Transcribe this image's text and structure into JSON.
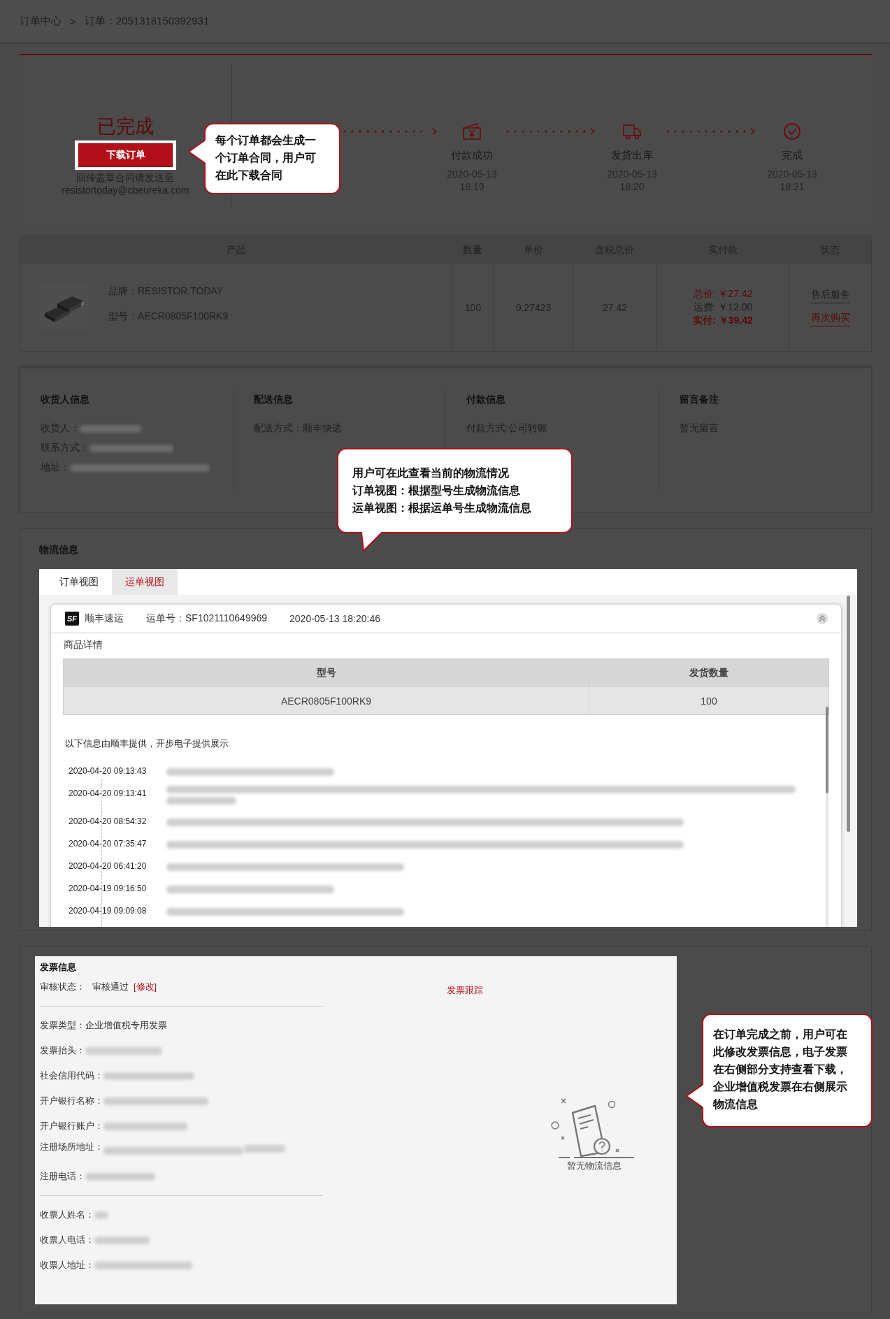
{
  "breadcrumb": {
    "items": [
      "订单中心",
      "订单：2051318150392931"
    ],
    "separator": ">"
  },
  "order_status": {
    "title": "已完成",
    "download_button": "下载订单",
    "note_lines": [
      "回传盖章合同请发送至",
      "resistortoday@cbeureka.com"
    ]
  },
  "steps": [
    {
      "kind": "payment",
      "label": "付款成功",
      "date": "2020-05-13",
      "time": "18:19"
    },
    {
      "kind": "shipping",
      "label": "发货出库",
      "date": "2020-05-13",
      "time": "18:20"
    },
    {
      "kind": "done",
      "label": "完成",
      "date": "2020-05-13",
      "time": "18:21"
    }
  ],
  "product_table": {
    "columns": [
      "产品",
      "数量",
      "单价",
      "含税总价",
      "实付款",
      "状态"
    ],
    "row": {
      "brand": "品牌：RESISTOR.TODAY",
      "model": "型号：AECR0805F100RK9",
      "quantity": "100",
      "unit_price": "0.27423",
      "total": "27.42",
      "payment": [
        {
          "kind": "total",
          "label": "总价:",
          "amount": "￥27.42"
        },
        {
          "kind": "fee",
          "label": "运费:",
          "amount": "￥12.00"
        },
        {
          "kind": "paid",
          "label": "实付:",
          "amount": "￥39.42"
        }
      ],
      "actions": [
        {
          "label": "售后服务",
          "kind": "plain"
        },
        {
          "label": "再次购买",
          "kind": "accent"
        }
      ]
    }
  },
  "info_sections": [
    {
      "title": "收货人信息",
      "fields": [
        {
          "label": "收货人：",
          "redacted": true
        },
        {
          "label": "联系方式：",
          "redacted": true
        },
        {
          "label": "地址：",
          "redacted": true
        }
      ]
    },
    {
      "title": "配送信息",
      "fields": [
        {
          "label": "配送方式：",
          "value": "顺丰快递",
          "redacted": false
        }
      ]
    },
    {
      "title": "付款信息",
      "fields": [
        {
          "label": "付款方式:",
          "value": "公司转账",
          "redacted": false
        }
      ]
    },
    {
      "title": "留言备注",
      "fields": [
        {
          "label": "暂无留言",
          "redacted": false
        }
      ]
    }
  ],
  "logistics": {
    "title": "物流信息",
    "tabs": [
      {
        "label": "订单视图",
        "selected": false
      },
      {
        "label": "运单视图",
        "selected": true
      }
    ],
    "carrier": {
      "logo": "SF",
      "name": "顺丰速运",
      "waybill": "运单号：SF1021110649969",
      "time": "2020-05-13 18:20:46"
    },
    "details_title": "商品详情",
    "details_table": {
      "columns": [
        "型号",
        "发货数量"
      ],
      "rows": [
        [
          "AECR0805F100RK9",
          "100"
        ]
      ]
    },
    "source_note": "以下信息由顺丰提供，开步电子提供展示",
    "events": [
      {
        "time": "2020-04-20 09:13:43",
        "kind": "short"
      },
      {
        "time": "2020-04-20 09:13:41",
        "kind": "double"
      },
      {
        "time": "2020-04-20 08:54:32",
        "kind": "long"
      },
      {
        "time": "2020-04-20 07:35:47",
        "kind": "long"
      },
      {
        "time": "2020-04-20 06:41:20",
        "kind": "medium"
      },
      {
        "time": "2020-04-19 09:16:50",
        "kind": "short"
      },
      {
        "time": "2020-04-19 09:09:08",
        "kind": "medium"
      }
    ]
  },
  "invoice": {
    "title": "发票信息",
    "review_label": "审核状态：",
    "review_value": "审核通过",
    "edit_link": "[修改]",
    "tracking_link": "发票跟踪",
    "groups": [
      [
        {
          "label": "发票类型：",
          "value": "企业增值税专用发票",
          "redacted": false
        },
        {
          "label": "发票抬头：",
          "redacted": true
        },
        {
          "label": "社会信用代码：",
          "redacted": true
        },
        {
          "label": "开户银行名称：",
          "redacted": true
        },
        {
          "label": "开户银行账户：",
          "redacted": true
        },
        {
          "label": "注册场所地址：",
          "redacted": true,
          "kind": "double"
        },
        {
          "label": "注册电话：",
          "redacted": true
        }
      ],
      [
        {
          "label": "收票人姓名：",
          "redacted": true
        },
        {
          "label": "收票人电话：",
          "redacted": true
        },
        {
          "label": "收票人地址：",
          "redacted": true
        }
      ]
    ],
    "empty_text": "暂无物流信息"
  },
  "callouts": [
    {
      "kind": "left",
      "text": "每个订单都会生成一个订单合同，用户可在此下载合同"
    },
    {
      "kind": "down",
      "lines": [
        "用户可在此查看当前的物流情况",
        "订单视图：根据型号生成物流信息",
        "运单视图：根据运单号生成物流信息"
      ]
    },
    {
      "kind": "left",
      "text": "在订单完成之前，用户可在此修改发票信息，电子发票在右侧部分支持查看下载，企业增值税发票在右侧展示物流信息"
    }
  ]
}
